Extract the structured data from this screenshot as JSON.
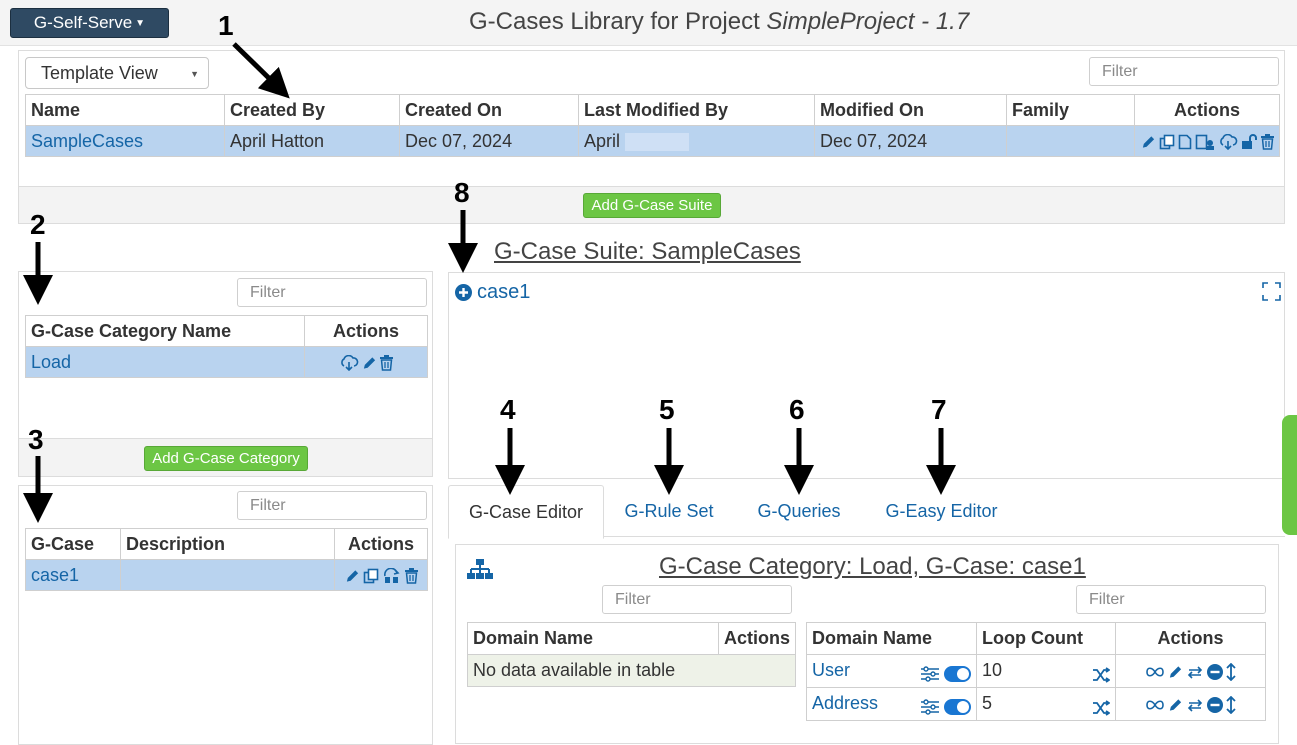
{
  "header": {
    "menu_button": "G-Self-Serve",
    "title_prefix": "G-Cases Library for Project ",
    "title_project": "SimpleProject",
    "title_version": " - 1.7"
  },
  "library": {
    "view_select": "Template View",
    "filter_placeholder": "Filter",
    "columns": [
      "Name",
      "Created By",
      "Created On",
      "Last Modified By",
      "Modified On",
      "Family",
      "Actions"
    ],
    "row": {
      "name": "SampleCases",
      "created_by": "April Hatton",
      "created_on": "Dec 07, 2024",
      "last_modified_by": "April",
      "modified_on": "Dec 07, 2024",
      "family": ""
    },
    "add_button": "Add G-Case Suite"
  },
  "categories": {
    "filter_placeholder": "Filter",
    "columns": [
      "G-Case Category Name",
      "Actions"
    ],
    "row": {
      "name": "Load"
    },
    "add_button": "Add G-Case Category"
  },
  "cases": {
    "filter_placeholder": "Filter",
    "columns": [
      "G-Case",
      "Description",
      "Actions"
    ],
    "row": {
      "name": "case1",
      "description": ""
    }
  },
  "suite": {
    "title": "G-Case Suite: SampleCases",
    "tree_item": "case1"
  },
  "tabs": [
    "G-Case Editor",
    "G-Rule Set",
    "G-Queries",
    "G-Easy Editor"
  ],
  "editor": {
    "title": "G-Case Category: Load, G-Case: case1",
    "left_filter": "Filter",
    "right_filter": "Filter",
    "left_columns": [
      "Domain Name",
      "Actions"
    ],
    "left_empty": "No data available in table",
    "right_columns": [
      "Domain Name",
      "Loop Count",
      "Actions"
    ],
    "rows": [
      {
        "domain": "User",
        "loop": "10"
      },
      {
        "domain": "Address",
        "loop": "5"
      }
    ]
  },
  "annotations": [
    "1",
    "2",
    "3",
    "4",
    "5",
    "6",
    "7",
    "8"
  ],
  "colors": {
    "accent": "#1565a6",
    "selected_row": "#b9d3ef",
    "green_button": "#6cc644",
    "dark_button": "#2f4a63"
  }
}
